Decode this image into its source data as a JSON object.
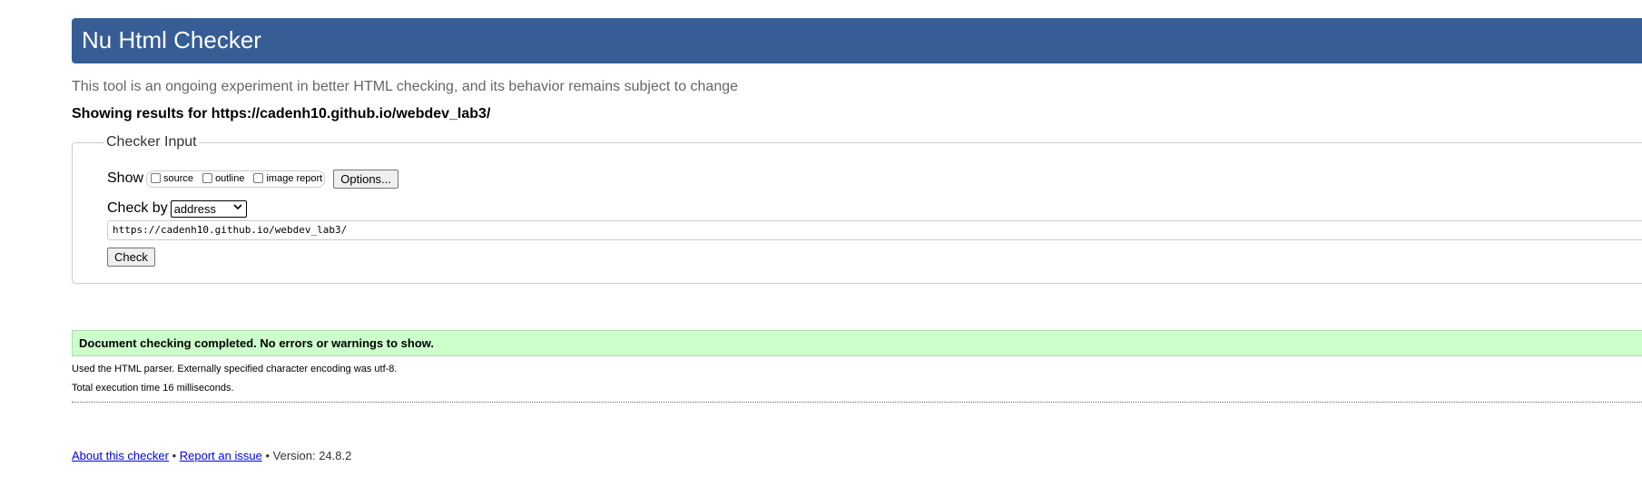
{
  "header": {
    "title": "Nu Html Checker"
  },
  "tagline": "This tool is an ongoing experiment in better HTML checking, and its behavior remains subject to change",
  "showing_results": "Showing results for https://cadenh10.github.io/webdev_lab3/",
  "checker_input": {
    "legend": "Checker Input",
    "show_label": "Show",
    "options": [
      {
        "label": "source",
        "checked": false
      },
      {
        "label": "outline",
        "checked": false
      },
      {
        "label": "image report",
        "checked": false
      }
    ],
    "options_button": "Options...",
    "check_by_label": "Check by",
    "check_by_selected": "address",
    "url_value": "https://cadenh10.github.io/webdev_lab3/",
    "check_button": "Check"
  },
  "result": {
    "message": "Document checking completed. No errors or warnings to show.",
    "parser_info": "Used the HTML parser. Externally specified character encoding was utf-8.",
    "execution_time": "Total execution time 16 milliseconds."
  },
  "footer": {
    "about_link": "About this checker",
    "separator": "•",
    "report_link": "Report an issue",
    "version": "Version: 24.8.2"
  },
  "colors": {
    "header_bg": "#365d95",
    "success_bg": "#ccffcc",
    "link": "#0000ee"
  }
}
